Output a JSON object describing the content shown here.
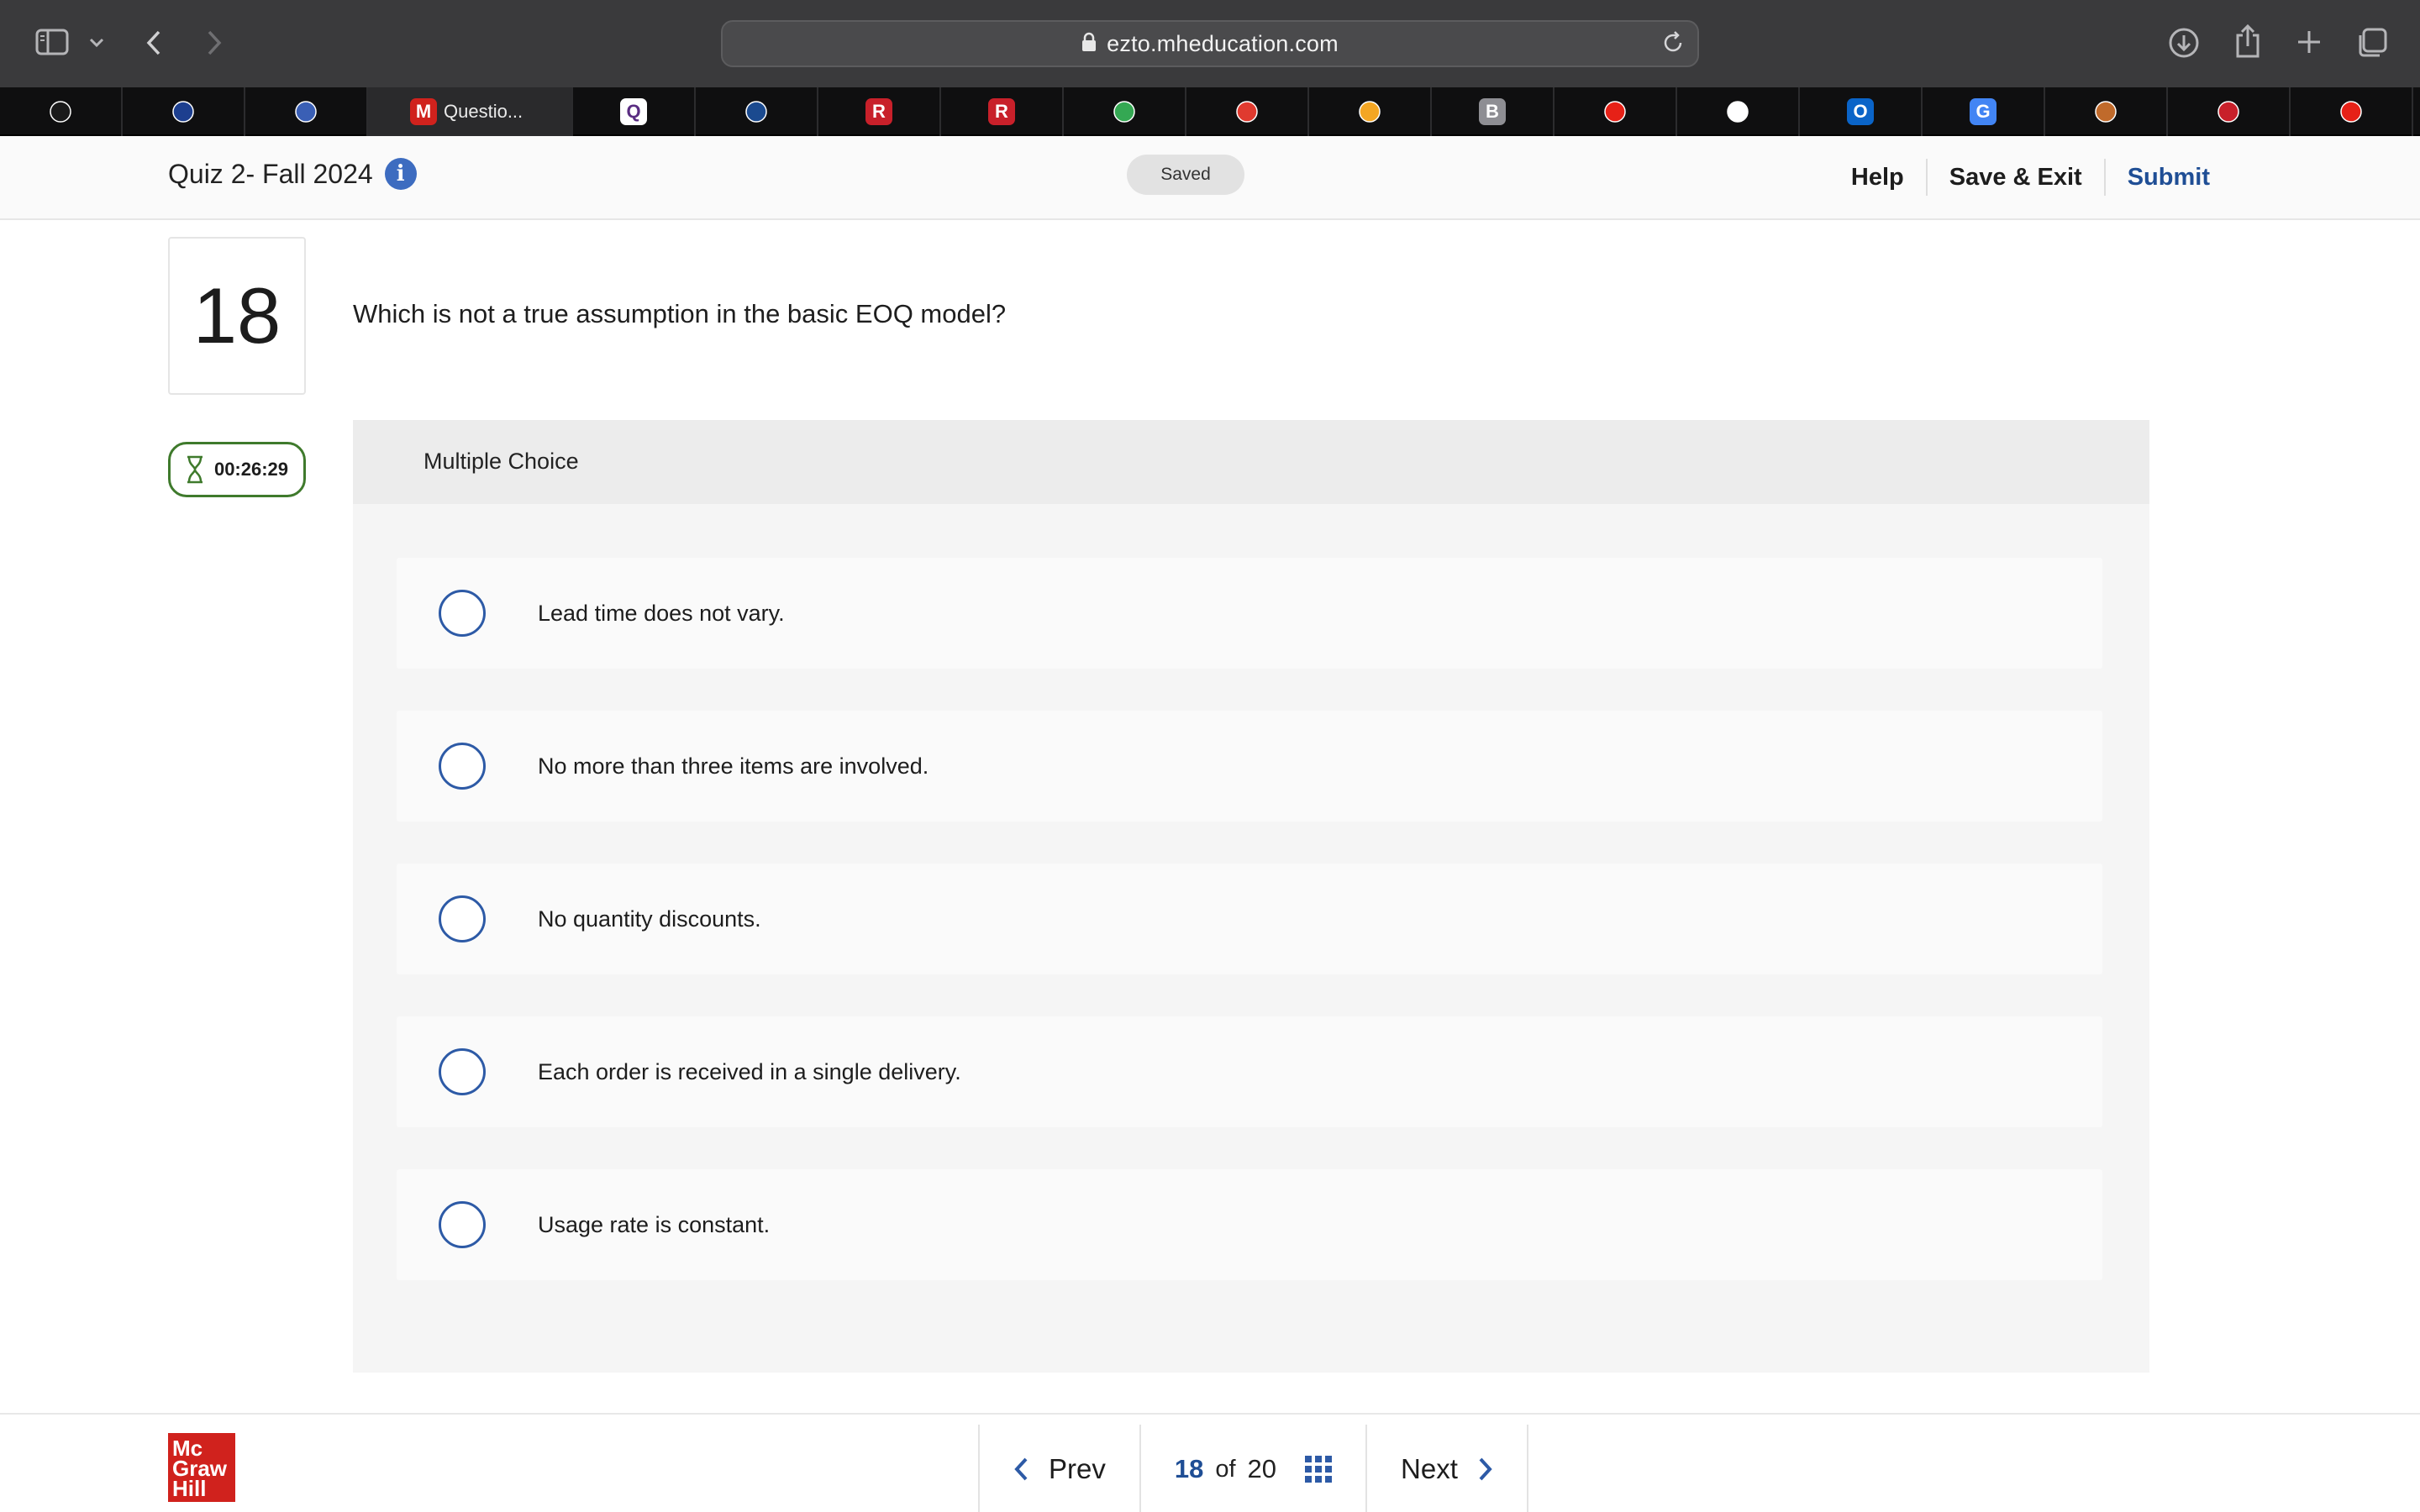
{
  "browser": {
    "url": "ezto.mheducation.com",
    "active_tab_title": "Questio...",
    "tabs": [
      {
        "icon": "chatgpt-icon",
        "color": "#1a1a1a"
      },
      {
        "icon": "star-badge-icon",
        "color": "#1d3f8f"
      },
      {
        "icon": "shield-crest-icon",
        "color": "#3a5fb5"
      },
      {
        "icon": "mcgraw-m-icon",
        "color": "#d0221d",
        "glyph": "M"
      },
      {
        "icon": "q-crown-icon",
        "color": "#ffffff",
        "glyph": "Q"
      },
      {
        "icon": "mail-icon",
        "color": "#1b4a8f"
      },
      {
        "icon": "r-logo-icon",
        "color": "#c8202a",
        "glyph": "R"
      },
      {
        "icon": "r-logo-icon",
        "color": "#c8202a",
        "glyph": "R"
      },
      {
        "icon": "maps-pin-icon",
        "color": "#34a853"
      },
      {
        "icon": "pill-icon",
        "color": "#e03a2f"
      },
      {
        "icon": "location-pin-icon",
        "color": "#f4a623"
      },
      {
        "icon": "b-letter-icon",
        "color": "#8e8e93",
        "glyph": "B"
      },
      {
        "icon": "youtube-icon",
        "color": "#e62117"
      },
      {
        "icon": "clock-circle-icon",
        "color": "#ffffff"
      },
      {
        "icon": "outlook-icon",
        "color": "#0a64c8",
        "glyph": "O"
      },
      {
        "icon": "google-icon",
        "color": "#4285f4",
        "glyph": "G"
      },
      {
        "icon": "mascot-icon",
        "color": "#c06a2b"
      },
      {
        "icon": "gift-icon",
        "color": "#c8202a"
      },
      {
        "icon": "youtube-icon",
        "color": "#e62117"
      }
    ]
  },
  "header": {
    "quiz_title": "Quiz 2- Fall 2024",
    "saved_label": "Saved",
    "help": "Help",
    "save_exit": "Save & Exit",
    "submit": "Submit"
  },
  "question": {
    "number": "18",
    "text": "Which is not a true assumption in the basic EOQ model?",
    "timer": "00:26:29",
    "type_label": "Multiple Choice",
    "options": [
      "Lead time does not vary.",
      "No more than three items are involved.",
      "No quantity discounts.",
      "Each order is received in a single delivery.",
      "Usage rate is constant."
    ]
  },
  "footer": {
    "logo_lines": [
      "Mc",
      "Graw",
      "Hill"
    ],
    "prev": "Prev",
    "current": "18",
    "of": "of",
    "total": "20",
    "next": "Next"
  },
  "colors": {
    "accent_blue": "#1f4e95",
    "radio_blue": "#2d5aa6",
    "timer_green": "#3f7a2c",
    "brand_red": "#d0221d"
  }
}
